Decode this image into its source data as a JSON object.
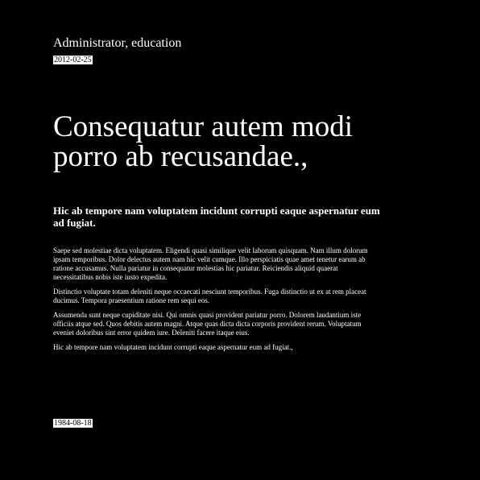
{
  "article": {
    "author": "Administrator, education",
    "date": "2012-02-25",
    "title": "Consequatur autem modi porro ab recusandae.,",
    "subtitle": "Hic ab tempore nam voluptatem incidunt corrupti eaque aspernatur eum ad fugiat.",
    "paragraphs": [
      "Saepe sed molestiae dicta voluptatem. Eligendi quasi similique velit laborum quisquam. Nam illum dolorum ipsam temporibus. Dolor delectus autem nam hic velit cumque. Illo perspiciatis quae amet tenetur earum ab ratione accusamus. Nulla pariatur in consequatur molestias hic pariatur. Reiciendis aliquid quaerat necessitatibus nobis iste iusto expedita.",
      "Distinctio voluptate totam deleniti neque occaecati nesciunt temporibus. Fuga distinctio ut ex at rem placeat ducimus. Tempora praesentium ratione rem sequi eos.",
      "Assumenda sunt neque cupiditate nisi. Qui omnis quasi provident pariatur porro. Dolorem laudantium iste officiis atque sed. Quos debitis autem magni. Atque quas dicta dicta corporis provident rerum. Voluptatum eveniet doloribus sint error quidem iure. Deleniti facere itaque eius.",
      "Hic ab tempore nam voluptatem incidunt corrupti eaque aspernatur eum ad fugiat.,"
    ],
    "footer_date": "1984-08-18"
  },
  "colors": {
    "background": "#000000",
    "text": "#ffffff",
    "date_highlight_bg": "#ffffff",
    "date_highlight_text": "#000000"
  }
}
